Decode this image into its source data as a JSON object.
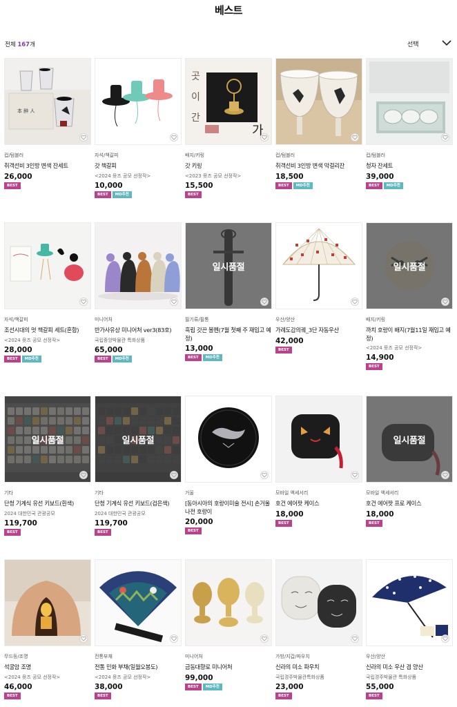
{
  "header": {
    "title": "베스트"
  },
  "list": {
    "count_prefix": "전체 ",
    "count": "167",
    "count_suffix": "개"
  },
  "sort": {
    "label": "선택"
  },
  "colors": {
    "best_badge": "#b9428a",
    "md_badge": "#5fb7c0",
    "count_accent": "#7a3fa0"
  },
  "soldout_label": "일시품절",
  "products": [
    {
      "category": "컵/텀블러",
      "name": "취객선비 3인방 변색 잔세트",
      "sub": "",
      "price": "26,000",
      "badges": [
        "BEST"
      ],
      "soldout": false
    },
    {
      "category": "자석/책갈피",
      "name": "갓 책갈피",
      "sub": "<2024 뮷즈 공모 선정작>",
      "price": "10,000",
      "badges": [
        "BEST",
        "MD추천"
      ],
      "soldout": false
    },
    {
      "category": "배지/키링",
      "name": "갓 키링",
      "sub": "<2023 뮷즈 공모 선정작>",
      "price": "15,500",
      "badges": [
        "BEST"
      ],
      "soldout": false
    },
    {
      "category": "컵/텀블러",
      "name": "취객선비 3인방 변색 막걸리잔",
      "sub": "",
      "price": "18,500",
      "badges": [
        "BEST",
        "MD추천"
      ],
      "soldout": false
    },
    {
      "category": "컵/텀블러",
      "name": "청자 잔세트",
      "sub": "",
      "price": "39,000",
      "badges": [
        "BEST",
        "MD추천"
      ],
      "soldout": false
    },
    {
      "category": "자석/책갈피",
      "name": "조선시대의 멋 책갈피 세트(혼합)",
      "sub": "<2024 뮷즈 공모 선정작>",
      "price": "28,000",
      "badges": [
        "BEST",
        "MD추천"
      ],
      "soldout": false
    },
    {
      "category": "미니어처",
      "name": "반가사유상 미니어처 ver3(83호)",
      "sub": "국립중앙박물관 특화상품",
      "price": "65,000",
      "badges": [
        "BEST",
        "MD추천"
      ],
      "soldout": false
    },
    {
      "category": "필기류/필통",
      "name": "흑립 갓끈 볼펜(7월 첫째 주 재입고 예정)",
      "sub": "",
      "price": "13,000",
      "badges": [
        "BEST",
        "MD추천"
      ],
      "soldout": true
    },
    {
      "category": "우산/양산",
      "name": "가례도감의궤_3단 자동우산",
      "sub": "",
      "price": "42,000",
      "badges": [
        "BEST"
      ],
      "soldout": false
    },
    {
      "category": "배지/키링",
      "name": "까치 호랑이 배지(7월11일 재입고 예정)",
      "sub": "<2024 뮷즈 공모 선정작>",
      "price": "14,900",
      "badges": [
        "BEST"
      ],
      "soldout": true
    },
    {
      "category": "기타",
      "name": "단청 기계식 유선 키보드(흰색)",
      "sub": "2024 대한민국 관광공모",
      "price": "119,700",
      "badges": [
        "BEST"
      ],
      "soldout": true
    },
    {
      "category": "기타",
      "name": "단청 기계식 유선 키보드(검은색)",
      "sub": "2024 대한민국 관광공모",
      "price": "119,700",
      "badges": [
        "BEST"
      ],
      "soldout": true
    },
    {
      "category": "거울",
      "name": "[동아시아의 호랑이미술 전시] 손거울 나전 호랑이",
      "sub": "",
      "price": "20,000",
      "badges": [
        "BEST"
      ],
      "soldout": false
    },
    {
      "category": "모바일 액세서리",
      "name": "호건 에어팟 케이스",
      "sub": "",
      "price": "18,000",
      "badges": [
        "BEST"
      ],
      "soldout": false
    },
    {
      "category": "모바일 액세서리",
      "name": "호건 에어팟 프로 케이스",
      "sub": "",
      "price": "18,000",
      "badges": [
        "BEST"
      ],
      "soldout": true
    },
    {
      "category": "무드등/조명",
      "name": "석굴암 조명",
      "sub": "<2024 뮷즈 공모 선정작>",
      "price": "46,000",
      "badges": [
        "BEST"
      ],
      "soldout": false
    },
    {
      "category": "전통부채",
      "name": "전통 민화 부채(일월오봉도)",
      "sub": "<2024 뮷즈 공모 선정작>",
      "price": "38,000",
      "badges": [
        "BEST"
      ],
      "soldout": false
    },
    {
      "category": "미니어처",
      "name": "금동대향로 미니어처",
      "sub": "",
      "price": "99,000",
      "badges": [
        "BEST",
        "MD추천"
      ],
      "soldout": false
    },
    {
      "category": "가방/지갑/파우치",
      "name": "신라의 미소 파우치",
      "sub": "국립경주박물관특화상품",
      "price": "23,000",
      "badges": [
        "BEST"
      ],
      "soldout": false
    },
    {
      "category": "우산/양산",
      "name": "신라의 미소 우산 겸 양산",
      "sub": "국립경주박물관 특화상품",
      "price": "55,000",
      "badges": [
        "BEST"
      ],
      "soldout": false
    }
  ]
}
